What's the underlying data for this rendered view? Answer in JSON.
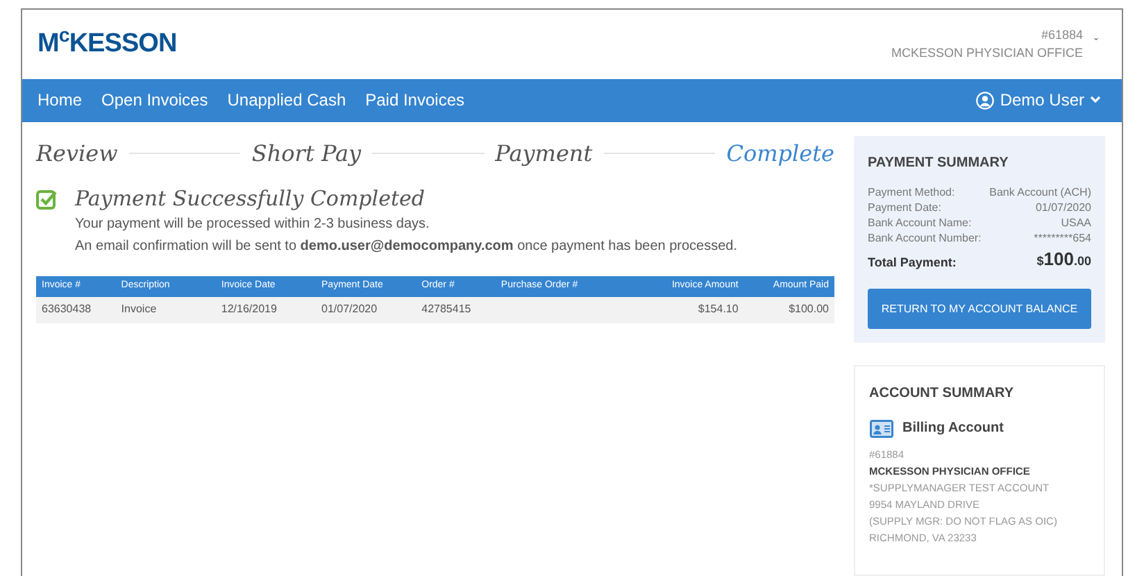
{
  "header": {
    "logo": "M$^{c}$KESSON",
    "account_number": "#61884",
    "account_name": "MCKESSON PHYSICIAN OFFICE",
    "caret": "ˇ"
  },
  "nav": {
    "items": [
      "Home",
      "Open Invoices",
      "Unapplied Cash",
      "Paid Invoices"
    ],
    "user": "Demo User"
  },
  "steps": [
    {
      "label": "Review",
      "selected": false
    },
    {
      "label": "Short Pay",
      "selected": false
    },
    {
      "label": "Payment",
      "selected": false
    },
    {
      "label": "Complete",
      "selected": true
    }
  ],
  "success": {
    "title": "Payment Successfully Completed",
    "line_1": "Your payment will be processed within 2-3 business days.",
    "line_2": "An email confirmation will be sent to **demo.user@democompany.com** once payment has been processed."
  },
  "table": {
    "columns": [
      {
        "label": "Invoice #",
        "kind": "text"
      },
      {
        "label": "Description",
        "kind": "text"
      },
      {
        "label": "Invoice Date",
        "kind": "text"
      },
      {
        "label": "Payment Date",
        "kind": "text"
      },
      {
        "label": "Order #",
        "kind": "text"
      },
      {
        "label": "Purchase Order #",
        "kind": "text"
      },
      {
        "label": "Invoice Amount",
        "kind": "amount"
      },
      {
        "label": "Amount Paid",
        "kind": "amount"
      }
    ],
    "rows": [
      [
        "63630438",
        "Invoice",
        "12/16/2019",
        "01/07/2020",
        "42785415",
        "",
        "$154.10",
        "$100.00"
      ]
    ]
  },
  "payment_summary": {
    "title": "PAYMENT SUMMARY",
    "rows": [
      {
        "label": "Payment Method:",
        "value": "Bank Account (ACH)"
      },
      {
        "label": "Payment Date:",
        "value": "01/07/2020"
      },
      {
        "label": "Bank Account Name:",
        "value": "USAA"
      },
      {
        "label": "Bank Account Number:",
        "value": "*********654"
      }
    ],
    "total_label": "Total Payment:",
    "total_value": "$**100**.00",
    "button": "RETURN TO MY ACCOUNT BALANCE"
  },
  "account_summary": {
    "title": "ACCOUNT SUMMARY",
    "account_type": "Billing Account",
    "lines": [
      {
        "kind": "muted",
        "text": "#61884"
      },
      {
        "kind": "bold",
        "text": "MCKESSON PHYSICIAN OFFICE"
      },
      {
        "kind": "muted",
        "text": "*SUPPLYMANAGER TEST ACCOUNT"
      },
      {
        "kind": "muted",
        "text": "9954 MAYLAND DRIVE"
      },
      {
        "kind": "muted",
        "text": "(SUPPLY MGR: DO NOT FLAG AS OIC)"
      },
      {
        "kind": "muted",
        "text": "RICHMOND, VA 23233"
      }
    ]
  }
}
